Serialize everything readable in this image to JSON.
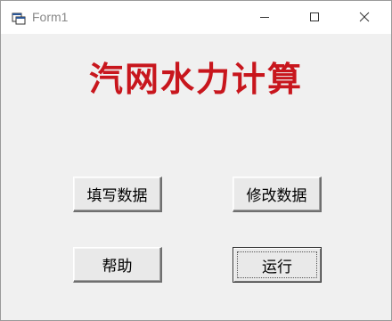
{
  "window": {
    "title": "Form1",
    "icon": "form-app-icon",
    "controls": {
      "minimize": "minimize-icon",
      "maximize": "maximize-icon",
      "close": "close-icon"
    }
  },
  "form": {
    "heading": "汽网水力计算",
    "heading_color": "#c8161d",
    "buttons": {
      "fill_data": "填写数据",
      "modify_data": "修改数据",
      "help": "帮助",
      "run": "运行"
    }
  }
}
